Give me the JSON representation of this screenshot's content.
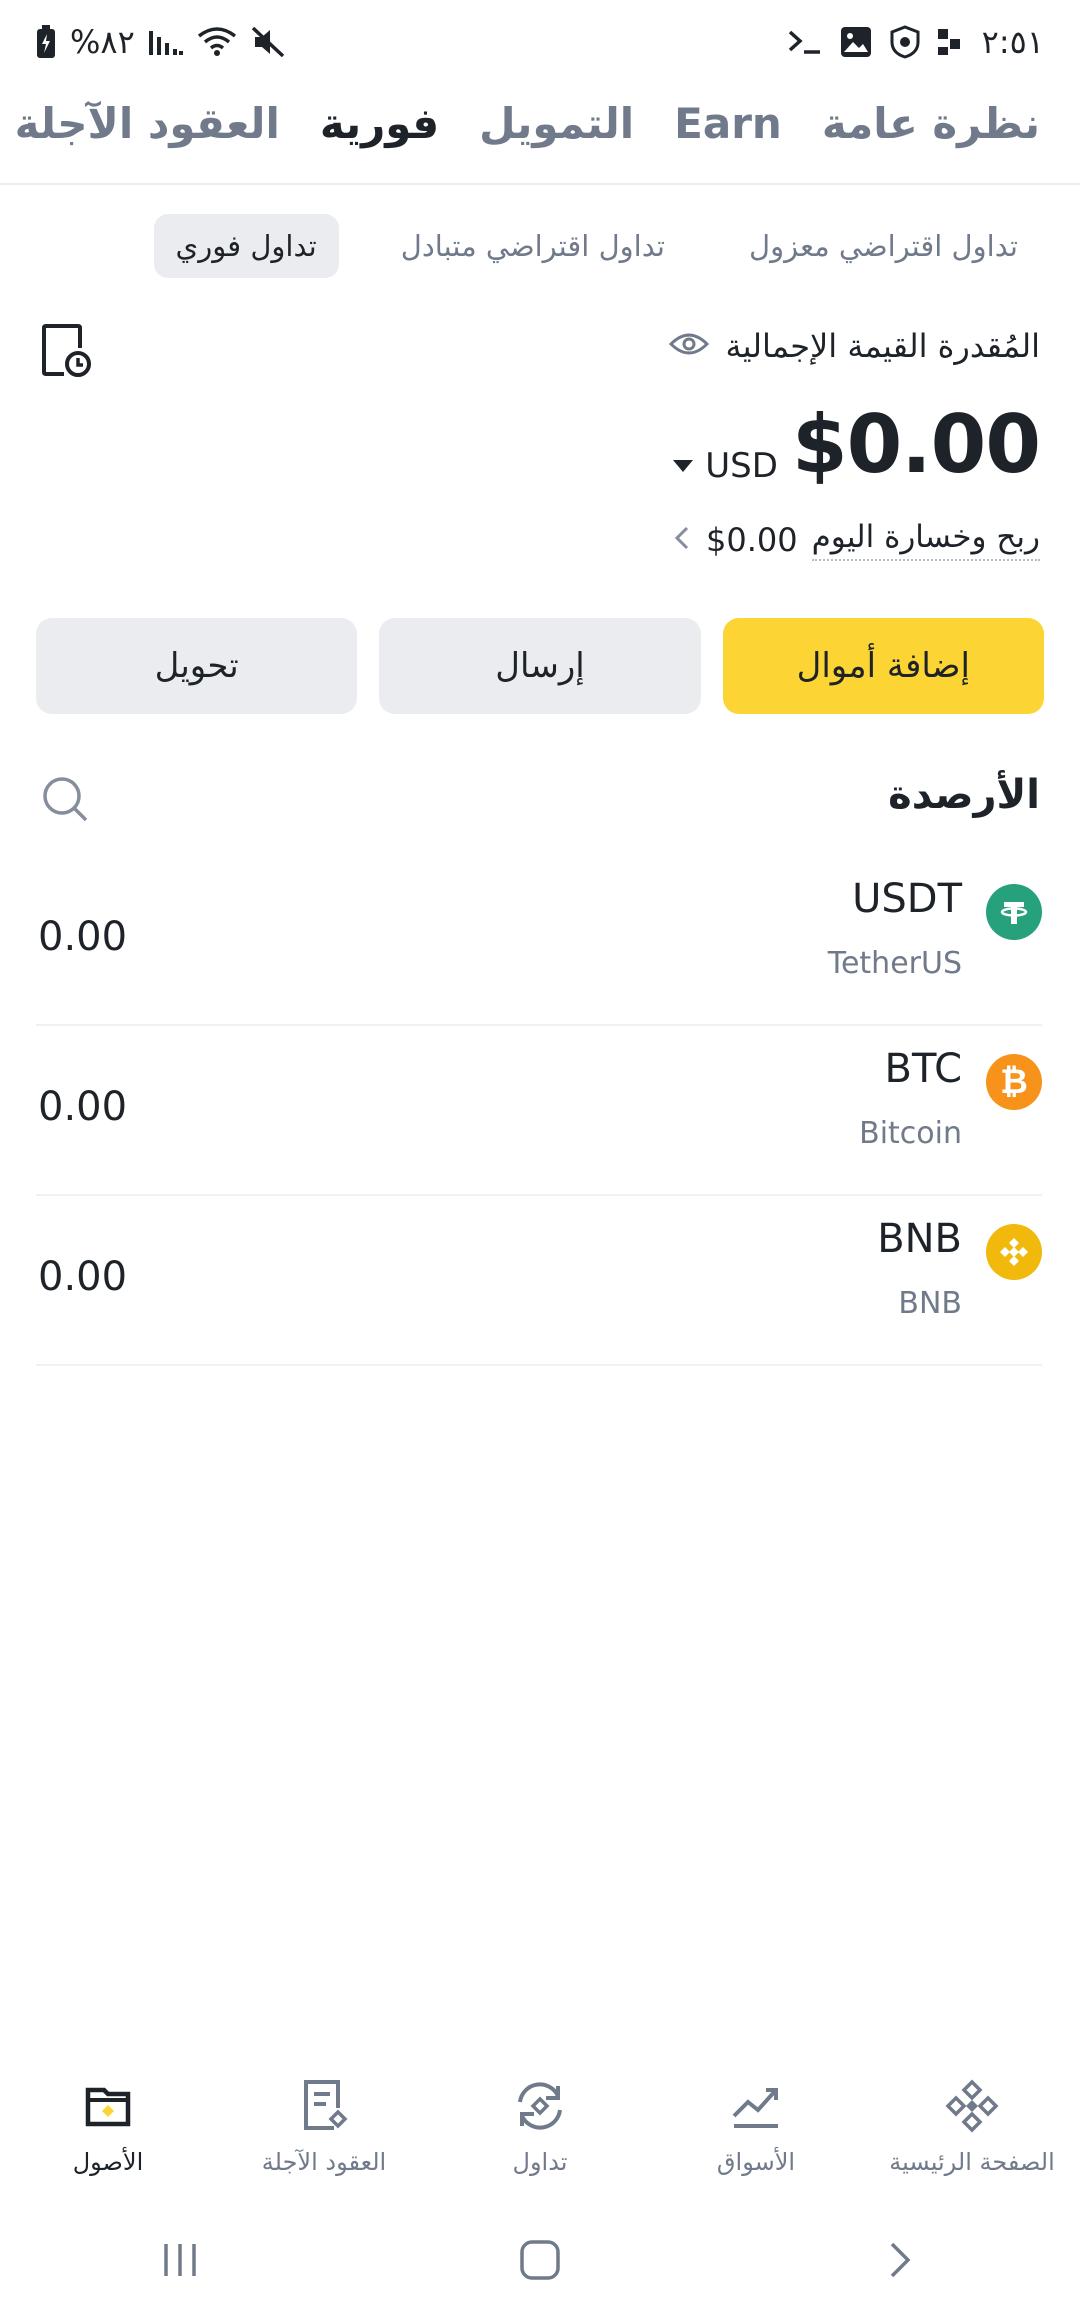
{
  "status_bar": {
    "time": "٢:٥١",
    "battery": "%٨٢"
  },
  "main_tabs": [
    {
      "label": "نظرة عامة"
    },
    {
      "label": "Earn"
    },
    {
      "label": "التمويل"
    },
    {
      "label": "فورية",
      "active": true
    },
    {
      "label": "العقود الآجلة"
    }
  ],
  "sub_tabs": [
    {
      "label": "تداول فوري",
      "active": true
    },
    {
      "label": "تداول اقتراضي متبادل"
    },
    {
      "label": "تداول اقتراضي معزول"
    }
  ],
  "balance": {
    "estimated_label": "المُقدرة القيمة الإجمالية",
    "amount": "$0.00",
    "currency": "USD",
    "pnl_label": "ربح وخسارة اليوم",
    "pnl_value": "$0.00"
  },
  "actions": {
    "add_funds": "إضافة أموال",
    "send": "إرسال",
    "transfer": "تحويل"
  },
  "balances_title": "الأرصدة",
  "assets": [
    {
      "symbol": "USDT",
      "name": "TetherUS",
      "amount": "0.00",
      "color": "#26a17b",
      "icon": "tether-icon"
    },
    {
      "symbol": "BTC",
      "name": "Bitcoin",
      "amount": "0.00",
      "color": "#f7931a",
      "icon": "bitcoin-icon"
    },
    {
      "symbol": "BNB",
      "name": "BNB",
      "amount": "0.00",
      "color": "#f0b90b",
      "icon": "bnb-icon"
    }
  ],
  "bottom_nav": [
    {
      "label": "الصفحة الرئيسية",
      "icon": "home-diamond-icon"
    },
    {
      "label": "الأسواق",
      "icon": "markets-chart-icon"
    },
    {
      "label": "تداول",
      "icon": "trade-icon"
    },
    {
      "label": "العقود الآجلة",
      "icon": "futures-doc-icon"
    },
    {
      "label": "الأصول",
      "icon": "wallet-icon",
      "active": true
    }
  ],
  "colors": {
    "brand_yellow": "#fcd535",
    "text_primary": "#1e2329",
    "text_secondary": "#707a8a",
    "button_gray": "#eaecef"
  }
}
